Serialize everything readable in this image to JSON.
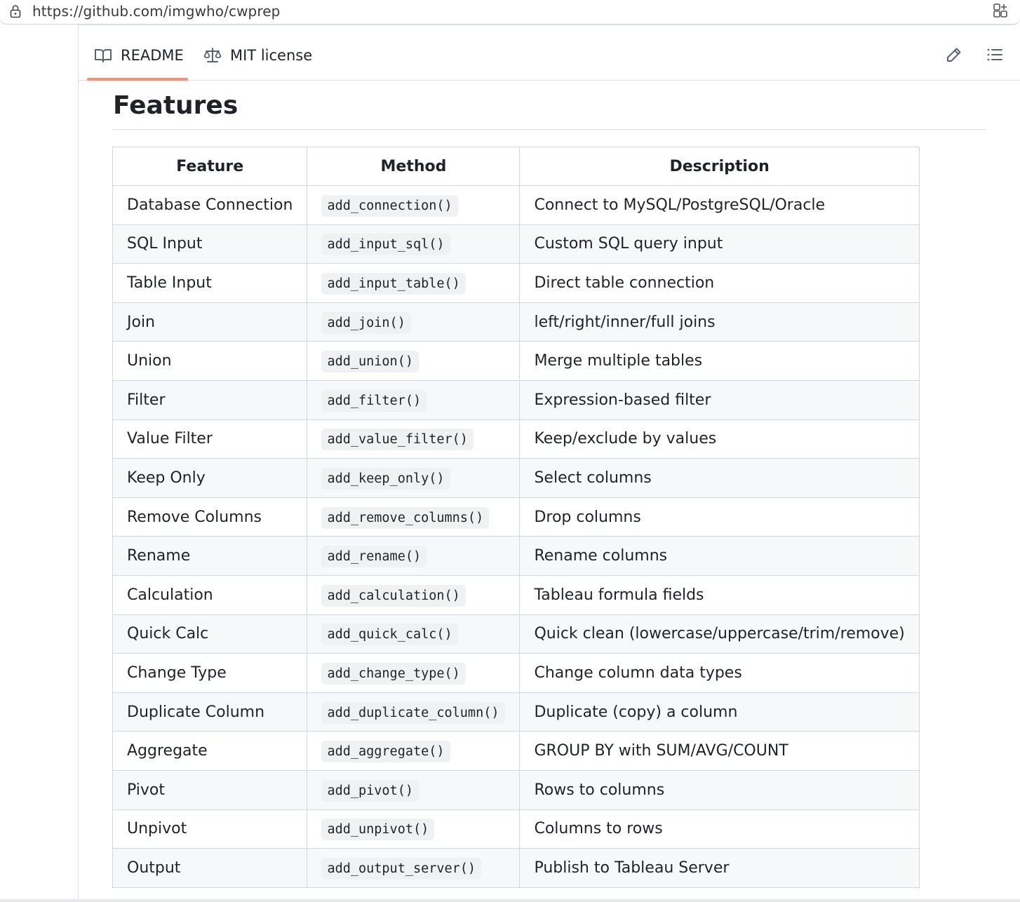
{
  "browser": {
    "url": "https://github.com/imgwho/cwprep"
  },
  "tabs": {
    "readme_label": "README",
    "license_label": "MIT license"
  },
  "content": {
    "heading": "Features",
    "table": {
      "headers": [
        "Feature",
        "Method",
        "Description"
      ],
      "rows": [
        {
          "feature": "Database Connection",
          "method": "add_connection()",
          "description": "Connect to MySQL/PostgreSQL/Oracle"
        },
        {
          "feature": "SQL Input",
          "method": "add_input_sql()",
          "description": "Custom SQL query input"
        },
        {
          "feature": "Table Input",
          "method": "add_input_table()",
          "description": "Direct table connection"
        },
        {
          "feature": "Join",
          "method": "add_join()",
          "description": "left/right/inner/full joins"
        },
        {
          "feature": "Union",
          "method": "add_union()",
          "description": "Merge multiple tables"
        },
        {
          "feature": "Filter",
          "method": "add_filter()",
          "description": "Expression-based filter"
        },
        {
          "feature": "Value Filter",
          "method": "add_value_filter()",
          "description": "Keep/exclude by values"
        },
        {
          "feature": "Keep Only",
          "method": "add_keep_only()",
          "description": "Select columns"
        },
        {
          "feature": "Remove Columns",
          "method": "add_remove_columns()",
          "description": "Drop columns"
        },
        {
          "feature": "Rename",
          "method": "add_rename()",
          "description": "Rename columns"
        },
        {
          "feature": "Calculation",
          "method": "add_calculation()",
          "description": "Tableau formula fields"
        },
        {
          "feature": "Quick Calc",
          "method": "add_quick_calc()",
          "description": "Quick clean (lowercase/uppercase/trim/remove)"
        },
        {
          "feature": "Change Type",
          "method": "add_change_type()",
          "description": "Change column data types"
        },
        {
          "feature": "Duplicate Column",
          "method": "add_duplicate_column()",
          "description": "Duplicate (copy) a column"
        },
        {
          "feature": "Aggregate",
          "method": "add_aggregate()",
          "description": "GROUP BY with SUM/AVG/COUNT"
        },
        {
          "feature": "Pivot",
          "method": "add_pivot()",
          "description": "Rows to columns"
        },
        {
          "feature": "Unpivot",
          "method": "add_unpivot()",
          "description": "Columns to rows"
        },
        {
          "feature": "Output",
          "method": "add_output_server()",
          "description": "Publish to Tableau Server"
        }
      ]
    }
  },
  "icons": {
    "lock": "lock-icon",
    "extensions": "extensions-icon",
    "readme_tab": "book-icon",
    "license_tab": "law-scale-icon",
    "edit": "pencil-icon",
    "outline": "list-icon"
  },
  "colors": {
    "active_tab_underline": "#fd8c73",
    "border": "#d0d7de",
    "row_alt": "#f6f8fa",
    "code_bg": "#eff1f3"
  }
}
